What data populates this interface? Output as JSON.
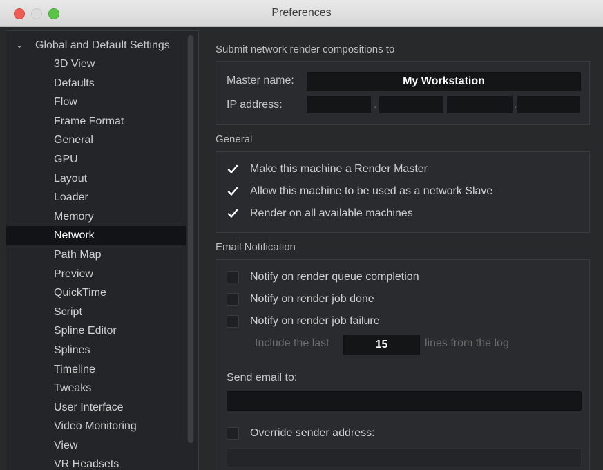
{
  "window": {
    "title": "Preferences"
  },
  "sidebar": {
    "root_label": "Global and Default Settings",
    "items": [
      "3D View",
      "Defaults",
      "Flow",
      "Frame Format",
      "General",
      "GPU",
      "Layout",
      "Loader",
      "Memory",
      "Network",
      "Path Map",
      "Preview",
      "QuickTime",
      "Script",
      "Spline Editor",
      "Splines",
      "Timeline",
      "Tweaks",
      "User Interface",
      "Video Monitoring",
      "View",
      "VR Headsets"
    ],
    "selected": "Network"
  },
  "submit": {
    "heading": "Submit network render compositions to",
    "master_label": "Master name:",
    "master_value": "My Workstation",
    "ip_label": "IP address:",
    "ip_separators": [
      ".",
      ".",
      "."
    ]
  },
  "general": {
    "heading": "General",
    "options": [
      {
        "label": "Make this machine a Render Master",
        "checked": true
      },
      {
        "label": "Allow this machine to be used as a network Slave",
        "checked": true
      },
      {
        "label": "Render on all available machines",
        "checked": true
      }
    ]
  },
  "email": {
    "heading": "Email Notification",
    "options": [
      {
        "label": "Notify on render queue completion",
        "checked": false
      },
      {
        "label": "Notify on render job done",
        "checked": false
      },
      {
        "label": "Notify on render job failure",
        "checked": false
      }
    ],
    "include_prefix": "Include the last",
    "include_count": "15",
    "include_suffix": "lines from the log",
    "send_to_label": "Send email to:",
    "send_to_value": "",
    "override_label": "Override sender address:",
    "override_checked": false
  },
  "colors": {
    "accent_selected": "#121316",
    "background": "#28292b",
    "checkmark": "#ffffff"
  },
  "icons": {
    "expand": "chevron-down-icon",
    "check": "checkmark-icon"
  }
}
